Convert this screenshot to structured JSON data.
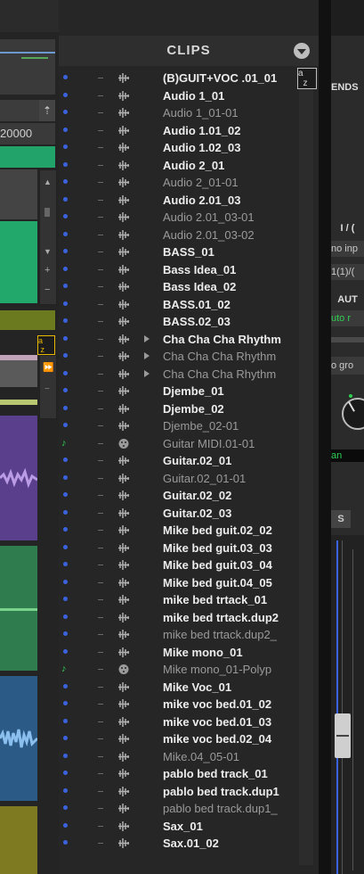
{
  "clips": {
    "title": "CLIPS",
    "sort_icon": "sort-az-icon",
    "rows": [
      {
        "name": "(B)GUIT+VOC .01_01",
        "kind": "audio",
        "active": true
      },
      {
        "name": "Audio 1_01",
        "kind": "audio",
        "active": true
      },
      {
        "name": "Audio 1_01-01",
        "kind": "audio",
        "active": false
      },
      {
        "name": "Audio 1.01_02",
        "kind": "audio",
        "active": true
      },
      {
        "name": "Audio 1.02_03",
        "kind": "audio",
        "active": true
      },
      {
        "name": "Audio 2_01",
        "kind": "audio",
        "active": true
      },
      {
        "name": "Audio 2_01-01",
        "kind": "audio",
        "active": false
      },
      {
        "name": "Audio 2.01_03",
        "kind": "audio",
        "active": true
      },
      {
        "name": "Audio 2.01_03-01",
        "kind": "audio",
        "active": false
      },
      {
        "name": "Audio 2.01_03-02",
        "kind": "audio",
        "active": false
      },
      {
        "name": "BASS_01",
        "kind": "audio",
        "active": true
      },
      {
        "name": "Bass Idea_01",
        "kind": "audio",
        "active": true
      },
      {
        "name": "Bass Idea_02",
        "kind": "audio",
        "active": true
      },
      {
        "name": "BASS.01_02",
        "kind": "audio",
        "active": true
      },
      {
        "name": "BASS.02_03",
        "kind": "audio",
        "active": true
      },
      {
        "name": "Cha Cha Cha Rhythm",
        "kind": "group",
        "active": true
      },
      {
        "name": "Cha Cha Cha Rhythm",
        "kind": "group",
        "active": false
      },
      {
        "name": "Cha Cha Cha Rhythm",
        "kind": "group",
        "active": false
      },
      {
        "name": "Djembe_01",
        "kind": "audio",
        "active": true
      },
      {
        "name": "Djembe_02",
        "kind": "audio",
        "active": true
      },
      {
        "name": "Djembe_02-01",
        "kind": "audio",
        "active": false
      },
      {
        "name": "Guitar MIDI.01-01",
        "kind": "midi",
        "active": false
      },
      {
        "name": "Guitar.02_01",
        "kind": "audio",
        "active": true
      },
      {
        "name": "Guitar.02_01-01",
        "kind": "audio",
        "active": false
      },
      {
        "name": "Guitar.02_02",
        "kind": "audio",
        "active": true
      },
      {
        "name": "Guitar.02_03",
        "kind": "audio",
        "active": true
      },
      {
        "name": "Mike bed guit.02_02",
        "kind": "audio",
        "active": true
      },
      {
        "name": "Mike bed guit.03_03",
        "kind": "audio",
        "active": true
      },
      {
        "name": "Mike bed guit.03_04",
        "kind": "audio",
        "active": true
      },
      {
        "name": "Mike bed guit.04_05",
        "kind": "audio",
        "active": true
      },
      {
        "name": "mike bed trtack_01",
        "kind": "audio",
        "active": true
      },
      {
        "name": "mike bed trtack.dup2",
        "kind": "audio",
        "active": true
      },
      {
        "name": "mike bed trtack.dup2_",
        "kind": "audio",
        "active": false
      },
      {
        "name": "Mike mono_01",
        "kind": "audio",
        "active": true
      },
      {
        "name": "Mike mono_01-Polyp",
        "kind": "midi",
        "active": false
      },
      {
        "name": "Mike Voc_01",
        "kind": "audio",
        "active": true
      },
      {
        "name": "mike voc bed.01_02",
        "kind": "audio",
        "active": true
      },
      {
        "name": "mike voc bed.01_03",
        "kind": "audio",
        "active": true
      },
      {
        "name": "mike voc bed.02_04",
        "kind": "audio",
        "active": true
      },
      {
        "name": "Mike.04_05-01",
        "kind": "audio",
        "active": false
      },
      {
        "name": "pablo bed track_01",
        "kind": "audio",
        "active": true
      },
      {
        "name": "pablo bed track.dup1",
        "kind": "audio",
        "active": true
      },
      {
        "name": "pablo bed track.dup1_",
        "kind": "audio",
        "active": false
      },
      {
        "name": "Sax_01",
        "kind": "audio",
        "active": true
      },
      {
        "name": "Sax.01_02",
        "kind": "audio",
        "active": true
      }
    ]
  },
  "left_panel": {
    "counter_value": "20000",
    "sort_icon": "sort-az-icon"
  },
  "right_panel": {
    "sends_label": "ENDS",
    "io_label": "I / (",
    "input_label": "no inp",
    "output_label": "1(1)/(",
    "auto_label": "AUT",
    "auto_mode": "uto r",
    "group_label": "o gro",
    "pan_label": "an",
    "s_label": "S"
  },
  "colors": {
    "accent_green": "#22b36c",
    "track_purple": "#5a3f8c",
    "track_green": "#2f7d4e",
    "track_blue": "#2b5a86",
    "track_olive": "#7d7a22",
    "active_dot": "#3b63e0",
    "sort_badge": "#e8b800"
  }
}
